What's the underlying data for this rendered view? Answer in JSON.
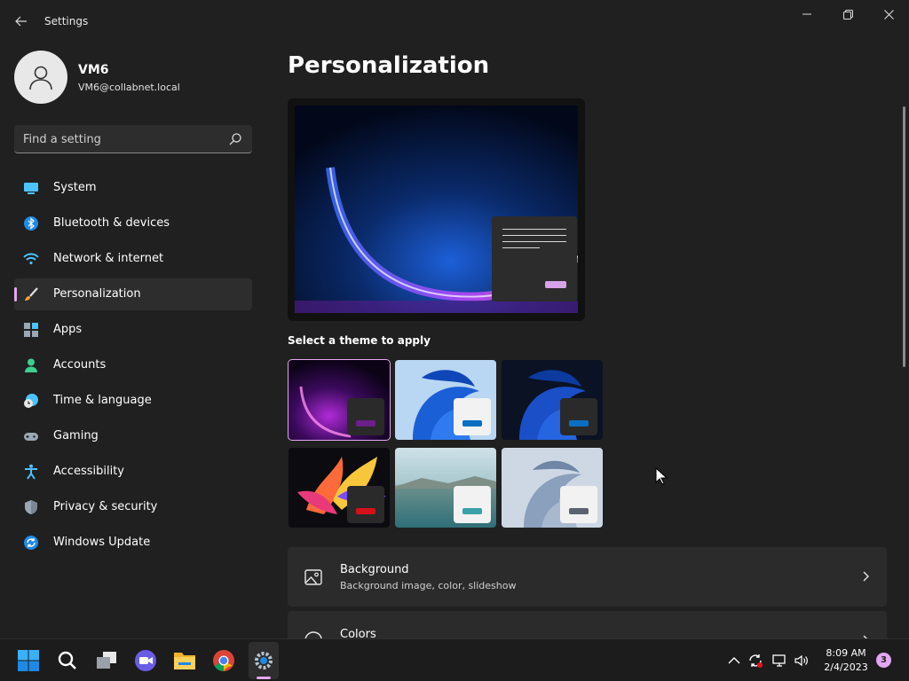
{
  "window": {
    "title": "Settings"
  },
  "profile": {
    "name": "VM6",
    "email": "VM6@collabnet.local"
  },
  "search": {
    "placeholder": "Find a setting"
  },
  "nav": {
    "items": [
      {
        "label": "System",
        "icon": "monitor-icon"
      },
      {
        "label": "Bluetooth & devices",
        "icon": "bluetooth-icon"
      },
      {
        "label": "Network & internet",
        "icon": "wifi-icon"
      },
      {
        "label": "Personalization",
        "icon": "brush-icon",
        "active": true
      },
      {
        "label": "Apps",
        "icon": "apps-icon"
      },
      {
        "label": "Accounts",
        "icon": "person-icon"
      },
      {
        "label": "Time & language",
        "icon": "clock-globe-icon"
      },
      {
        "label": "Gaming",
        "icon": "gamepad-icon"
      },
      {
        "label": "Accessibility",
        "icon": "accessibility-icon"
      },
      {
        "label": "Privacy & security",
        "icon": "shield-icon"
      },
      {
        "label": "Windows Update",
        "icon": "update-icon"
      }
    ]
  },
  "main": {
    "title": "Personalization",
    "themes_label": "Select a theme to apply",
    "themes": [
      {
        "icon": "glow-dark-theme",
        "accent": "#6b1f8a",
        "selected": true
      },
      {
        "icon": "bloom-light-theme",
        "accent": "#0a6fc2"
      },
      {
        "icon": "bloom-dark-theme",
        "accent": "#0a6fc2"
      },
      {
        "icon": "captured-motion-theme",
        "accent": "#d4111b"
      },
      {
        "icon": "sunrise-lake-theme",
        "accent": "#3aa0a8"
      },
      {
        "icon": "flow-theme",
        "accent": "#5b6270"
      }
    ],
    "cards": [
      {
        "title": "Background",
        "subtitle": "Background image, color, slideshow",
        "icon": "image-icon"
      },
      {
        "title": "Colors",
        "subtitle": "",
        "icon": "palette-icon"
      }
    ]
  },
  "taskbar": {
    "apps": [
      "windows-start-icon",
      "search-icon",
      "task-view-icon",
      "teams-chat-icon",
      "file-explorer-icon",
      "chrome-icon",
      "settings-icon"
    ],
    "time": "8:09 AM",
    "date": "2/4/2023",
    "notifications": "3"
  },
  "colors": {
    "accent": "#e4a6f0",
    "background": "#202020",
    "card": "#2b2b2b"
  }
}
